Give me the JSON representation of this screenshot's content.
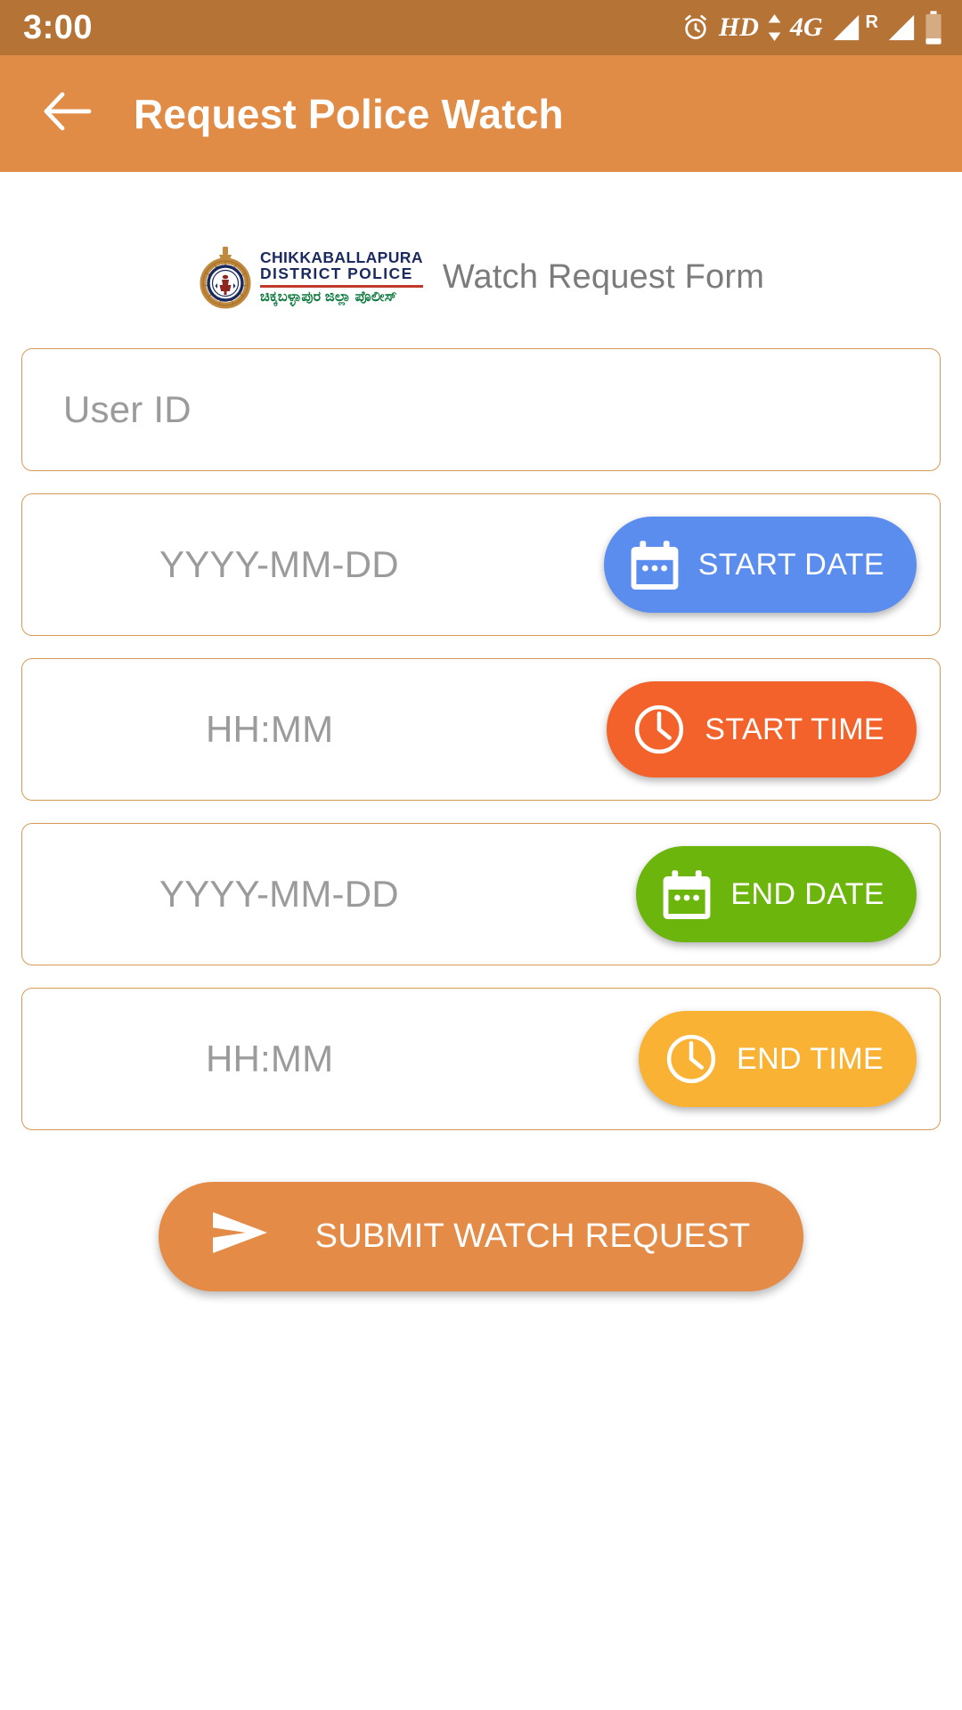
{
  "status_bar": {
    "time": "3:00",
    "alarm_icon": "alarm-clock-icon",
    "hd_label": "HD",
    "data_arrows_icon": "data-transfer-arrows-icon",
    "network_label": "4G",
    "signal_icon": "signal-bars-icon",
    "roaming_label": "R",
    "signal_icon_2": "signal-bars-icon",
    "battery_icon": "battery-icon"
  },
  "app_bar": {
    "back_icon": "back-arrow-icon",
    "title": "Request Police Watch",
    "background": "#e08c46"
  },
  "form_header": {
    "logo": {
      "emblem_icon": "police-emblem-icon",
      "line1": "CHIKKABALLAPURA",
      "line2": "DISTRICT POLICE",
      "kannada": "ಚಿಕ್ಕಬಳ್ಳಾಪುರ ಜಿಲ್ಲಾ ಪೊಲೀಸ್",
      "line_color": "#1b2a5e",
      "rule_color": "#c0392b",
      "kannada_color": "#0c7a3d"
    },
    "caption": "Watch Request Form"
  },
  "fields": [
    {
      "name": "user-id",
      "placeholder": "User ID",
      "value": "",
      "action": null
    },
    {
      "name": "start-date",
      "placeholder": "YYYY-MM-DD",
      "value": "",
      "action": {
        "label": "START DATE",
        "icon": "calendar-icon",
        "color": "#5b8def"
      }
    },
    {
      "name": "start-time",
      "placeholder": "HH:MM",
      "value": "",
      "action": {
        "label": "START TIME",
        "icon": "clock-icon",
        "color": "#f2622a"
      }
    },
    {
      "name": "end-date",
      "placeholder": "YYYY-MM-DD",
      "value": "",
      "action": {
        "label": "END DATE",
        "icon": "calendar-icon",
        "color": "#6cb50c"
      }
    },
    {
      "name": "end-time",
      "placeholder": "HH:MM",
      "value": "",
      "action": {
        "label": "END TIME",
        "icon": "clock-icon",
        "color": "#f9b233"
      }
    }
  ],
  "submit": {
    "label": "SUBMIT WATCH REQUEST",
    "icon": "send-arrow-icon",
    "color": "#e38b47"
  },
  "colors": {
    "status_bar": "#b57336",
    "accent_orange": "#e08c46",
    "field_border": "#d79a56",
    "placeholder_text": "#9b9b9b",
    "caption_text": "#7b7b7b"
  }
}
